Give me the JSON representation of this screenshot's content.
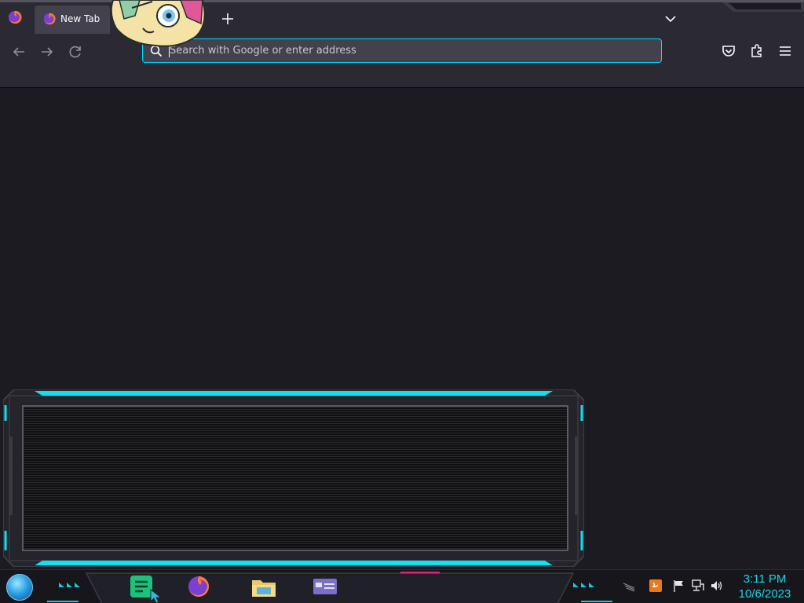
{
  "browser": {
    "tab": {
      "title": "New Tab"
    },
    "urlbar": {
      "placeholder": "Search with Google or enter address"
    }
  },
  "taskbar": {
    "apps": [
      "notes-app",
      "firefox",
      "file-explorer",
      "settings-panel"
    ],
    "clock": {
      "time": "3:11 PM",
      "date": "10/6/2023"
    }
  },
  "colors": {
    "accent": "#00ddff",
    "clock": "#18d6e6",
    "toolbar": "#2b2a33",
    "content": "#1c1b22"
  }
}
